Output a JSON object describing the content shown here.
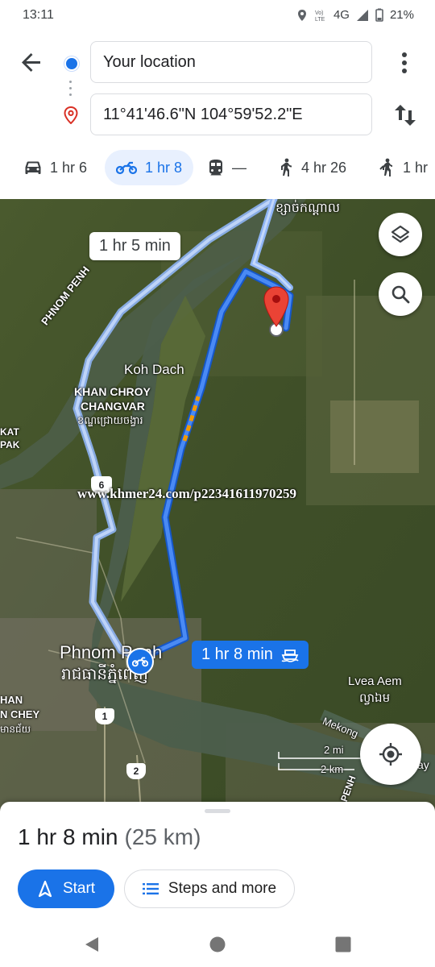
{
  "status_bar": {
    "time": "13:11",
    "network": "4G",
    "battery": "21%"
  },
  "directions": {
    "origin": "Your location",
    "destination": "11°41'46.6\"N 104°59'52.2\"E"
  },
  "modes": [
    {
      "icon": "car-icon",
      "label": "1 hr 6"
    },
    {
      "icon": "motorcycle-icon",
      "label": "1 hr 8",
      "selected": true
    },
    {
      "icon": "transit-icon",
      "label": "—"
    },
    {
      "icon": "walk-icon",
      "label": "4 hr 26"
    },
    {
      "icon": "ride-icon",
      "label": "1 hr"
    }
  ],
  "map": {
    "labels": {
      "khmer_top": "ខ្សាច់កណ្តាល",
      "phnom_penh_rot": "PHNOM PENH",
      "koh_dach": "Koh Dach",
      "khan_chroy_1": "KHAN CHROY",
      "khan_chroy_2": "CHANGVAR",
      "khan_chroy_km": "ខណ្ឌជ្រោយចង្វារ",
      "kat": "KAT",
      "pak": "PAK",
      "phnom_penh_city": "Phnom Penh",
      "phnom_penh_km": "រាជធានីភ្នំពេញ",
      "han": "HAN",
      "chey": "N CHEY",
      "chey_km": "មានជ័យ",
      "lvea_aem": "Lvea Aem",
      "lvea_aem_km": "ល្វាឯម",
      "mekong": "Mekong",
      "road_6": "6",
      "road_1": "1",
      "road_2": "2",
      "scale_mi": "2 mi",
      "scale_km": "2 km",
      "watermark": "www.khmer24.com/p22341611970259",
      "penh_side": "PENH",
      "ay": "ay"
    },
    "alt_route_time": "1 hr 5 min",
    "main_route_time": "1 hr 8 min"
  },
  "sheet": {
    "duration": "1 hr 8 min",
    "distance": "(25 km)",
    "start_label": "Start",
    "steps_label": "Steps and more"
  },
  "colors": {
    "accent": "#1a73e8",
    "route": "#3b78e7",
    "alt_route": "#a8c7fa",
    "pin": "#ea4335"
  }
}
